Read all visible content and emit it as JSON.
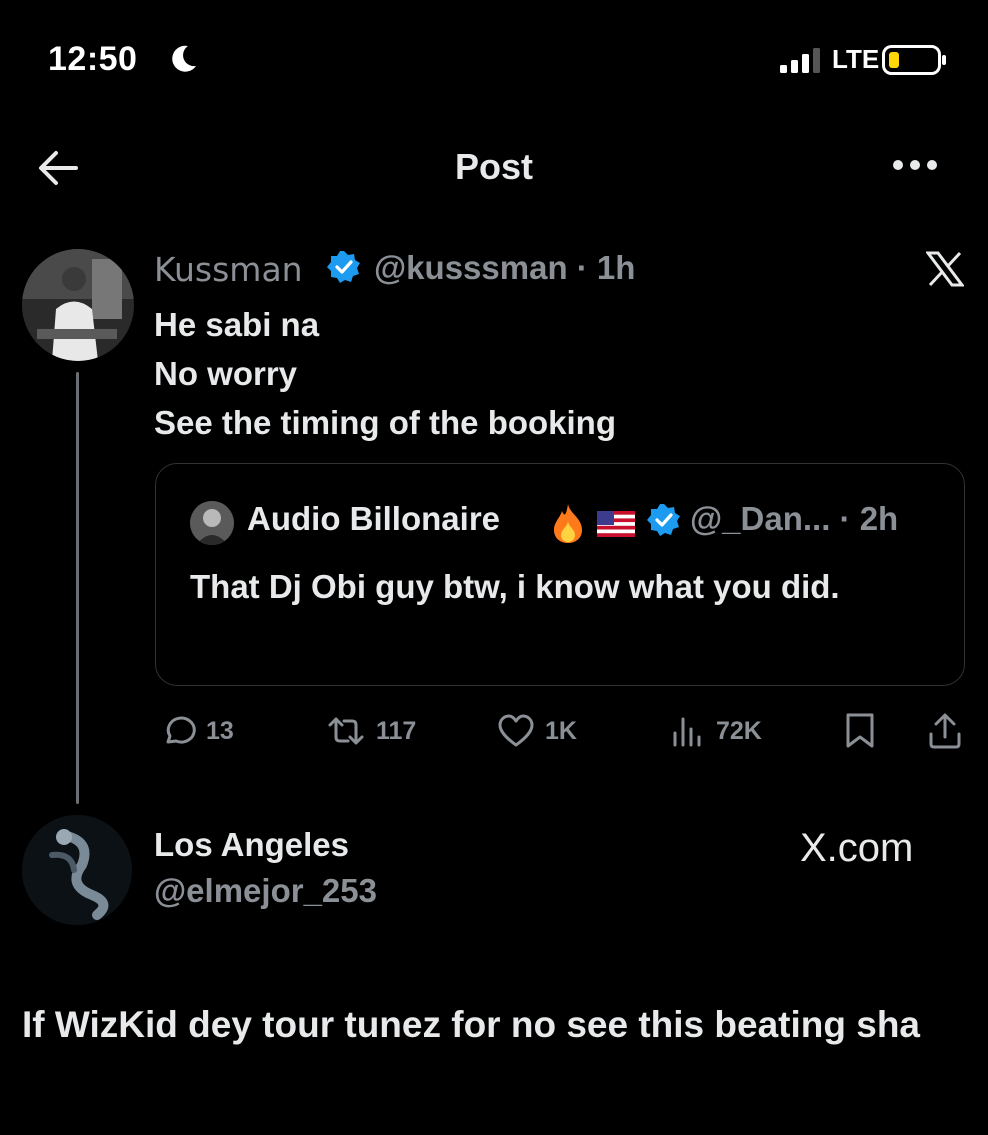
{
  "status_bar": {
    "time": "12:50",
    "network": "LTE",
    "icons": [
      "moon-icon",
      "signal-icon",
      "battery-icon"
    ]
  },
  "header": {
    "title": "Post",
    "icons": [
      "back-arrow-icon",
      "more-options-icon"
    ]
  },
  "tweet": {
    "author_name": "Kussman",
    "handle_time": "@kusssman · 1h",
    "body_lines": [
      "He sabi na",
      "No worry",
      "See the timing of the booking"
    ],
    "quoted": {
      "author_name": "Audio Billonaire",
      "handle_time": "@_Dan... · 2h",
      "body": "That Dj Obi guy btw, i know what you did."
    },
    "stats": {
      "replies": "13",
      "reposts": "117",
      "likes": "1K",
      "views": "72K"
    }
  },
  "reply": {
    "author_name": "Los Angeles",
    "handle": "@elmejor_253",
    "source": "X.com",
    "body": "If WizKid dey tour tunez for no see this beating sha"
  },
  "colors": {
    "background": "#000000",
    "text_primary": "#e7e9ea",
    "text_secondary": "#8b9096",
    "verified_blue": "#1d9bf0",
    "battery_yellow": "#ffd60a"
  }
}
